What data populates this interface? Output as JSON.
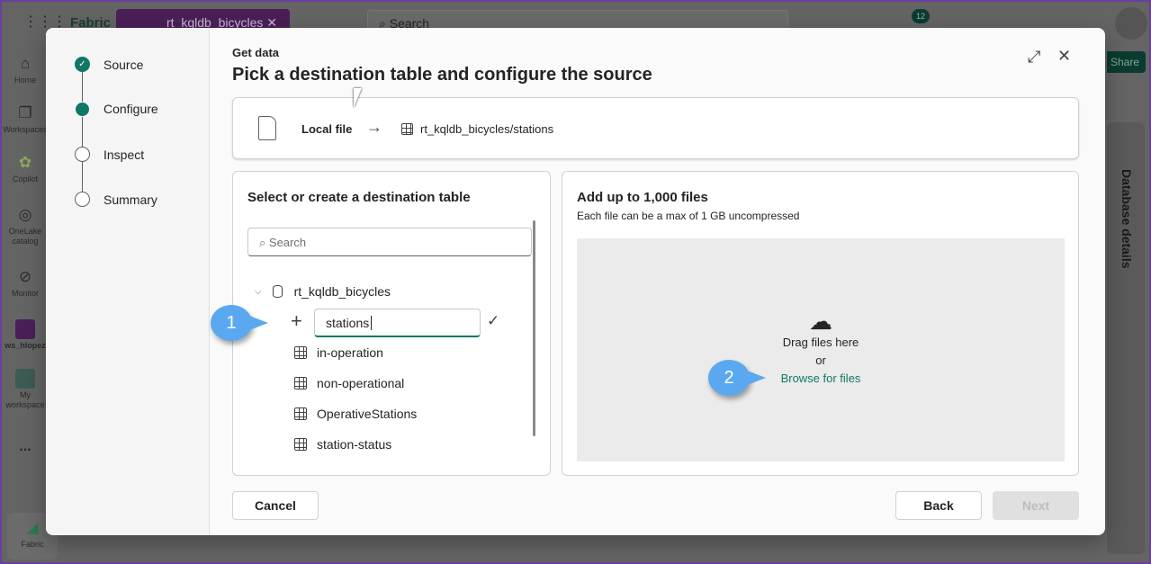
{
  "app": {
    "brand": "Fabric",
    "tab_label": "rt_kqldb_bicycles",
    "search_placeholder": "Search",
    "notification_count": "12",
    "share_label": "Share",
    "side_panel_title": "Database details",
    "rail": [
      {
        "label": "Home",
        "icon": "home-icon"
      },
      {
        "label": "Workspaces",
        "icon": "workspaces-icon"
      },
      {
        "label": "Copilot",
        "icon": "copilot-icon"
      },
      {
        "label": "OneLake catalog",
        "icon": "onelake-icon"
      },
      {
        "label": "Monitor",
        "icon": "monitor-icon"
      },
      {
        "label": "ws_hlopez",
        "icon": "workspace-icon"
      },
      {
        "label": "My workspace",
        "icon": "my-workspace-icon"
      }
    ],
    "more_label": "...",
    "fabric_label": "Fabric"
  },
  "dialog": {
    "eyebrow": "Get data",
    "title": "Pick a destination table and configure the source",
    "steps": [
      {
        "label": "Source",
        "state": "done"
      },
      {
        "label": "Configure",
        "state": "current"
      },
      {
        "label": "Inspect",
        "state": "pending"
      },
      {
        "label": "Summary",
        "state": "pending"
      }
    ],
    "source": {
      "label": "Local file",
      "destination": "rt_kqldb_bicycles/stations"
    },
    "left": {
      "title": "Select or create a destination table",
      "search_placeholder": "Search",
      "database": "rt_kqldb_bicycles",
      "new_table_value": "stations",
      "tables": [
        "in-operation",
        "non-operational",
        "OperativeStations",
        "station-status"
      ]
    },
    "right": {
      "title": "Add up to 1,000 files",
      "subtitle": "Each file can be a max of 1 GB uncompressed",
      "drag_text": "Drag files here",
      "or_text": "or",
      "browse_label": "Browse for files"
    },
    "callouts": [
      "1",
      "2"
    ],
    "buttons": {
      "cancel": "Cancel",
      "back": "Back",
      "next": "Next"
    },
    "accent": "#117865"
  }
}
